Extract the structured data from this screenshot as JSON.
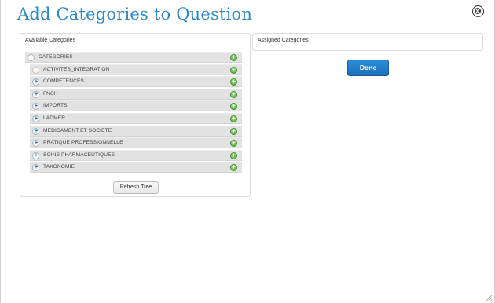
{
  "dialog": {
    "title": "Add Categories to Question"
  },
  "available": {
    "title": "Available Categories",
    "root": {
      "label": "CATEGORIES",
      "toggle": "−"
    },
    "items": [
      {
        "label": "ACTIVITES_INTEGRATION",
        "toggle": ""
      },
      {
        "label": "COMPETENCES",
        "toggle": "+"
      },
      {
        "label": "FNCH",
        "toggle": "+"
      },
      {
        "label": "IMPORTS",
        "toggle": "+"
      },
      {
        "label": "LADMER",
        "toggle": "+"
      },
      {
        "label": "MEDICAMENT ET SOCIETE",
        "toggle": "+"
      },
      {
        "label": "PRATIQUE PROFESSIONNELLE",
        "toggle": "+"
      },
      {
        "label": "SOINS PHARMACEUTIQUES",
        "toggle": "+"
      },
      {
        "label": "TAXONOMIE",
        "toggle": "+"
      }
    ],
    "add_glyph": "+",
    "refresh_label": "Refresh Tree"
  },
  "assigned": {
    "title": "Assigned Categories",
    "done_label": "Done"
  },
  "colors": {
    "title": "#2f86c8",
    "done": "#1f7cc8",
    "add": "#5cb43c"
  }
}
